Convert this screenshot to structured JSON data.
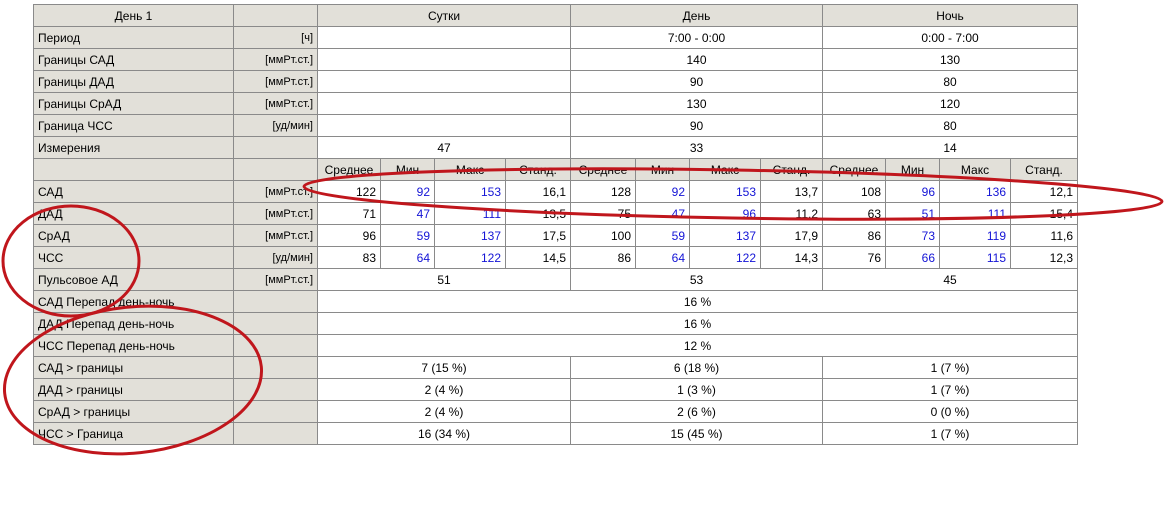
{
  "header": {
    "day": "День 1",
    "groups": [
      "Сутки",
      "День",
      "Ночь"
    ]
  },
  "info_rows": [
    {
      "label": "Период",
      "unit": "[ч]",
      "sutki": "",
      "day": "7:00 - 0:00",
      "night": "0:00 - 7:00"
    },
    {
      "label": "Границы САД",
      "unit": "[ммРт.ст.]",
      "sutki": "",
      "day": "140",
      "night": "130"
    },
    {
      "label": "Границы ДАД",
      "unit": "[ммРт.ст.]",
      "sutki": "",
      "day": "90",
      "night": "80"
    },
    {
      "label": "Границы СрАД",
      "unit": "[ммРт.ст.]",
      "sutki": "",
      "day": "130",
      "night": "120"
    },
    {
      "label": "Граница ЧСС",
      "unit": "[уд/мин]",
      "sutki": "",
      "day": "90",
      "night": "80"
    },
    {
      "label": "Измерения",
      "unit": "",
      "sutki": "47",
      "day": "33",
      "night": "14"
    }
  ],
  "stat_cols": [
    "Среднее",
    "Мин",
    "Макс",
    "Станд."
  ],
  "stats_rows": [
    {
      "label": "САД",
      "unit": "[ммРт.ст.]",
      "vals": [
        "122",
        "92",
        "153",
        "16,1",
        "128",
        "92",
        "153",
        "13,7",
        "108",
        "96",
        "136",
        "12,1"
      ]
    },
    {
      "label": "ДАД",
      "unit": "[ммРт.ст.]",
      "vals": [
        "71",
        "47",
        "111",
        "13,5",
        "75",
        "47",
        "96",
        "11,2",
        "63",
        "51",
        "111",
        "15,4"
      ]
    },
    {
      "label": "СрАД",
      "unit": "[ммРт.ст.]",
      "vals": [
        "96",
        "59",
        "137",
        "17,5",
        "100",
        "59",
        "137",
        "17,9",
        "86",
        "73",
        "119",
        "11,6"
      ]
    },
    {
      "label": "ЧСС",
      "unit": "[уд/мин]",
      "vals": [
        "83",
        "64",
        "122",
        "14,5",
        "86",
        "64",
        "122",
        "14,3",
        "76",
        "66",
        "115",
        "12,3"
      ]
    }
  ],
  "pulse": {
    "label": "Пульсовое АД",
    "unit": "[ммРт.ст.]",
    "sutki": "51",
    "day": "53",
    "night": "45"
  },
  "dn_rows": [
    {
      "label": "САД Перепад день-ночь",
      "value": "16 %"
    },
    {
      "label": "ДАД Перепад день-ночь",
      "value": "16 %"
    },
    {
      "label": "ЧСС Перепад день-ночь",
      "value": "12 %"
    }
  ],
  "exceed_rows": [
    {
      "label": "САД > границы",
      "sutki": "7 (15 %)",
      "day": "6 (18 %)",
      "night": "1 (7 %)"
    },
    {
      "label": "ДАД > границы",
      "sutki": "2 (4 %)",
      "day": "1 (3 %)",
      "night": "1 (7 %)"
    },
    {
      "label": "СрАД > границы",
      "sutki": "2 (4 %)",
      "day": "2 (6 %)",
      "night": "0 (0 %)"
    },
    {
      "label": "ЧСС  > Граница",
      "sutki": "16 (34 %)",
      "day": "15 (45 %)",
      "night": "1 (7 %)"
    }
  ],
  "colors": {
    "min_max_text": "#1414d6",
    "annotation": "#c0161c",
    "header_bg": "#e2e0d9"
  }
}
